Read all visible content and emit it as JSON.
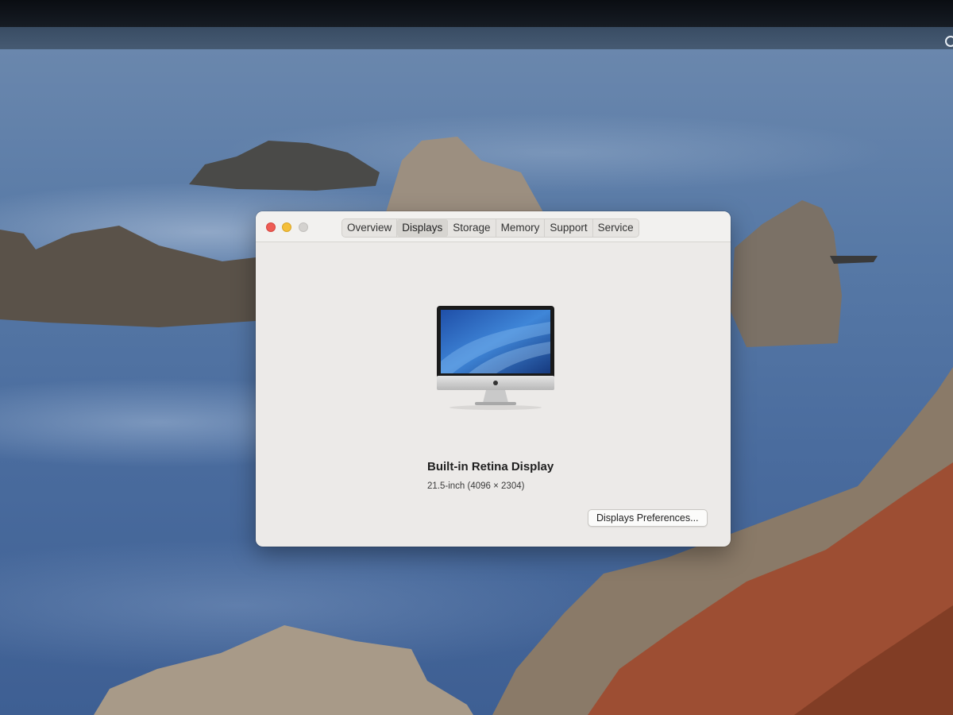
{
  "window": {
    "tabs": [
      {
        "label": "Overview"
      },
      {
        "label": "Displays"
      },
      {
        "label": "Storage"
      },
      {
        "label": "Memory"
      },
      {
        "label": "Support"
      },
      {
        "label": "Service"
      }
    ],
    "selected_tab": "Displays"
  },
  "display": {
    "icon": "imac-icon",
    "name": "Built-in Retina Display",
    "spec": "21.5-inch (4096 × 2304)"
  },
  "buttons": {
    "preferences": "Displays Preferences..."
  },
  "colors": {
    "close": "#ee5c54",
    "minimize": "#f4bf3a",
    "zoom_disabled": "#d4d2cf",
    "window_bg": "#eceae8"
  }
}
